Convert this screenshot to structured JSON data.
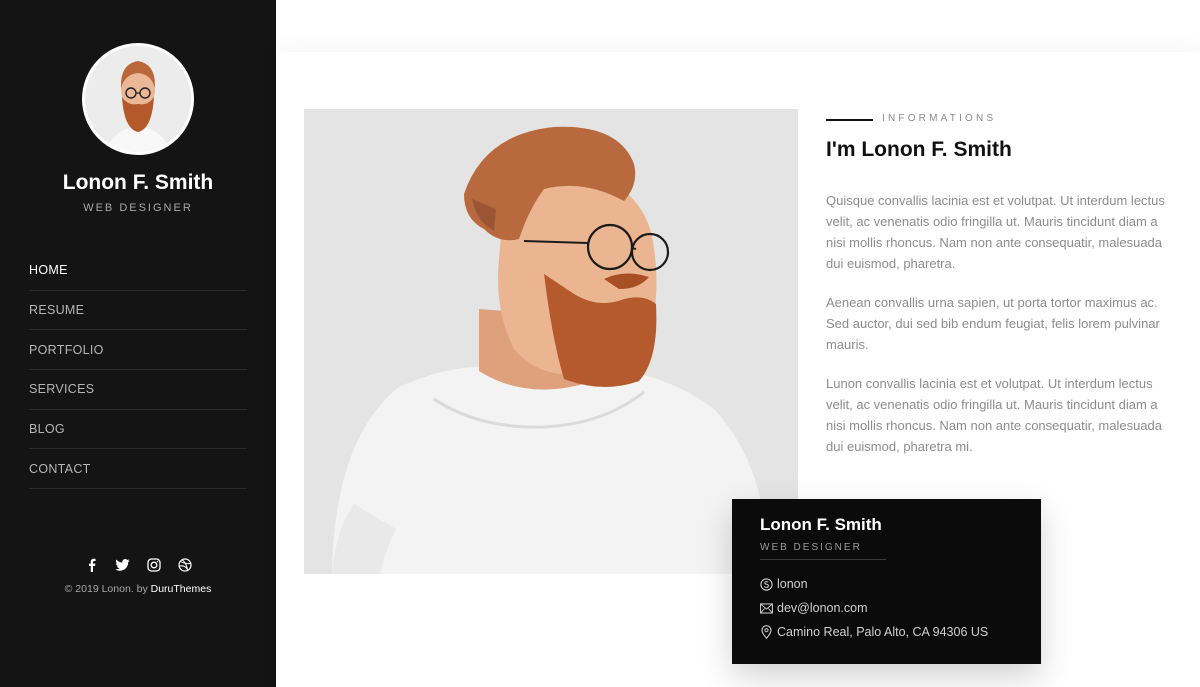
{
  "profile": {
    "name": "Lonon F. Smith",
    "role": "WEB DESIGNER"
  },
  "nav": {
    "items": [
      {
        "label": "HOME",
        "active": true
      },
      {
        "label": "RESUME"
      },
      {
        "label": "PORTFOLIO"
      },
      {
        "label": "SERVICES"
      },
      {
        "label": "BLOG"
      },
      {
        "label": "CONTACT"
      }
    ]
  },
  "social": [
    "facebook-icon",
    "twitter-icon",
    "instagram-icon",
    "dribbble-icon"
  ],
  "footer": {
    "copyright_prefix": "© 2019 Lonon. by ",
    "copyright_brand": "DuruThemes"
  },
  "about": {
    "section_label": "INFORMATIONS",
    "title": "I'm Lonon F. Smith",
    "paragraphs": [
      "Quisque convallis lacinia est et volutpat. Ut interdum lectus velit, ac venenatis odio fringilla ut. Mauris tincidunt diam a nisi mollis rhoncus. Nam non ante consequatir, malesuada dui euismod, pharetra.",
      "Aenean convallis urna sapien, ut porta tortor maximus ac. Sed auctor, dui sed bib endum feugiat, felis lorem pulvinar mauris.",
      "Lunon convallis lacinia est et volutpat. Ut interdum lectus velit, ac venenatis odio fringilla ut. Mauris tincidunt diam a nisi mollis rhoncus. Nam non ante consequatir, malesuada dui euismod, pharetra mi."
    ]
  },
  "card": {
    "name": "Lonon F. Smith",
    "role": "WEB DESIGNER",
    "skype": "lonon",
    "email": "dev@lonon.com",
    "address": "Camino Real, Palo Alto, CA 94306 US"
  },
  "colors": {
    "sidebar_bg": "#141414",
    "card_bg": "#0b0b0b",
    "text_muted": "#8c8c8c"
  }
}
